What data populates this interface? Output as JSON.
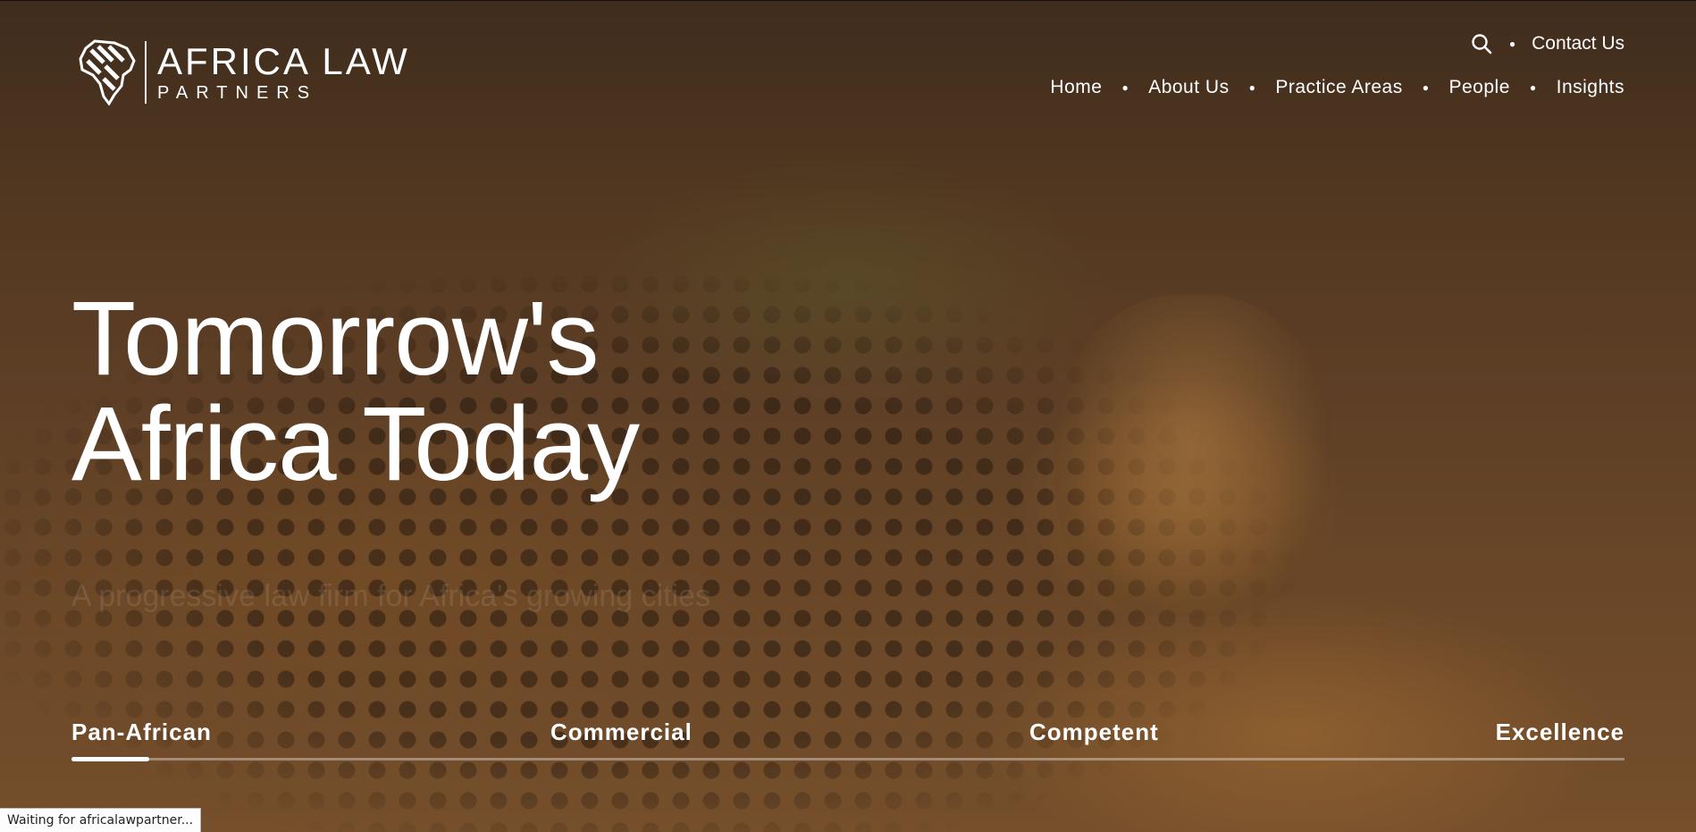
{
  "logo": {
    "title": "AFRICA LAW",
    "subtitle": "PARTNERS"
  },
  "header": {
    "search_icon": "search-icon",
    "contact_label": "Contact Us",
    "nav": [
      {
        "label": "Home"
      },
      {
        "label": "About Us"
      },
      {
        "label": "Practice Areas"
      },
      {
        "label": "People"
      },
      {
        "label": "Insights"
      }
    ]
  },
  "hero": {
    "title_line1": "Tomorrow's",
    "title_line2": "Africa Today",
    "subtitle": "A progressive law firm for Africa's growing cities"
  },
  "pillars": {
    "items": [
      {
        "label": "Pan-African"
      },
      {
        "label": "Commercial"
      },
      {
        "label": "Competent"
      },
      {
        "label": "Excellence"
      }
    ],
    "active_index": 0,
    "progress_fraction": 0.05
  },
  "status_bar": {
    "text": "Waiting for africalawpartner..."
  }
}
